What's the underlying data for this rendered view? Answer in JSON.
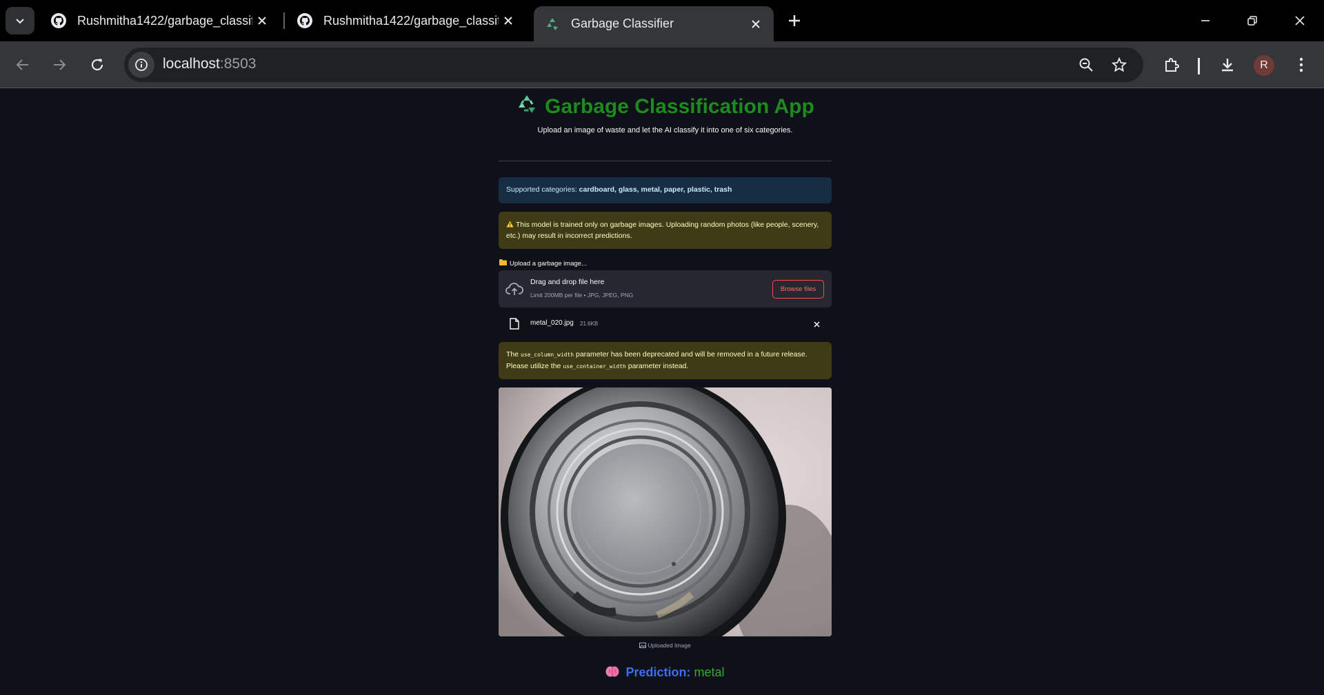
{
  "browser": {
    "tabs": [
      {
        "title": "Rushmitha1422/garbage_classifi",
        "icon": "github-icon",
        "active": false
      },
      {
        "title": "Rushmitha1422/garbage_classifi",
        "icon": "github-icon",
        "active": false
      },
      {
        "title": "Garbage Classifier",
        "icon": "recycle-icon",
        "active": true
      }
    ],
    "url_host": "localhost",
    "url_port": ":8503",
    "profile_initial": "R"
  },
  "app": {
    "title": "Garbage Classification App",
    "title_color": "#1f8a1f",
    "subtitle": "Upload an image of waste and let the AI classify it into one of six categories.",
    "info_prefix": "Supported categories: ",
    "info_categories": "cardboard, glass, metal, paper, plastic, trash",
    "warning": "This model is trained only on garbage images. Uploading random photos (like people, scenery, etc.) may result in incorrect predictions.",
    "uploader": {
      "label": "Upload a garbage image...",
      "drop_title": "Drag and drop file here",
      "drop_hint": "Limit 200MB per file • JPG, JPEG, PNG",
      "browse_label": "Browse files"
    },
    "file": {
      "name": "metal_020.jpg",
      "size": "21.6KB"
    },
    "deprecation": {
      "text1": "The ",
      "code1": "use_column_width",
      "text2": " parameter has been deprecated and will be removed in a future release. Please utilize the ",
      "code2": "use_container_width",
      "text3": " parameter instead."
    },
    "image_caption": "Uploaded Image",
    "prediction_label": "Prediction:",
    "prediction_value": "metal",
    "colors": {
      "background": "#0e1117",
      "info_bg": "#172d43",
      "warning_bg": "#3e3b16",
      "accent_red": "#ff4b4b",
      "prediction_blue": "#3f6cf0",
      "prediction_green": "#30b030"
    }
  }
}
